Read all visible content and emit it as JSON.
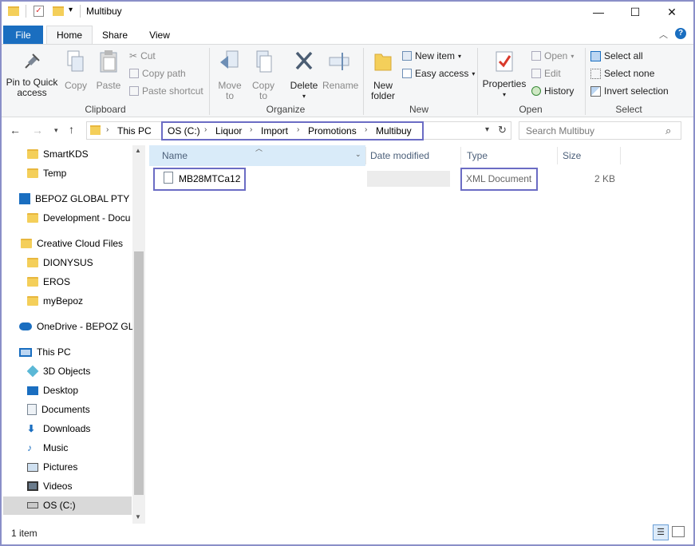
{
  "window": {
    "title": "Multibuy",
    "controls": {
      "minimize": "—",
      "maximize": "☐",
      "close": "✕"
    }
  },
  "ribbon_tabs": {
    "file": "File",
    "home": "Home",
    "share": "Share",
    "view": "View"
  },
  "ribbon": {
    "clipboard": {
      "label": "Clipboard",
      "pin": "Pin to Quick access",
      "copy": "Copy",
      "paste": "Paste",
      "cut": "Cut",
      "copy_path": "Copy path",
      "paste_shortcut": "Paste shortcut"
    },
    "organize": {
      "label": "Organize",
      "move_to": "Move to",
      "copy_to": "Copy to",
      "delete": "Delete",
      "rename": "Rename"
    },
    "new": {
      "label": "New",
      "new_folder": "New folder",
      "new_item": "New item",
      "easy_access": "Easy access"
    },
    "open": {
      "label": "Open",
      "properties": "Properties",
      "open": "Open",
      "edit": "Edit",
      "history": "History"
    },
    "select": {
      "label": "Select",
      "select_all": "Select all",
      "select_none": "Select none",
      "invert_selection": "Invert selection"
    }
  },
  "address": {
    "crumbs": [
      "This PC",
      "OS (C:)",
      "Liquor",
      "Import",
      "Promotions",
      "Multibuy"
    ],
    "search_placeholder": "Search Multibuy"
  },
  "nav_pane": [
    "SmartKDS",
    "Temp",
    "BEPOZ GLOBAL PTY LI",
    "Development - Docu",
    "Creative Cloud Files",
    "DIONYSUS",
    "EROS",
    "myBepoz",
    "OneDrive - BEPOZ GLC",
    "This PC",
    "3D Objects",
    "Desktop",
    "Documents",
    "Downloads",
    "Music",
    "Pictures",
    "Videos",
    "OS (C:)"
  ],
  "columns": {
    "name": "Name",
    "date_modified": "Date modified",
    "type": "Type",
    "size": "Size"
  },
  "files": [
    {
      "name": "MB28MTCa12",
      "date_modified": "",
      "type": "XML Document",
      "size": "2 KB"
    }
  ],
  "status": {
    "count": "1 item"
  },
  "colors": {
    "accent": "#1a6ec0",
    "highlight_box": "#6b6cc4",
    "folder": "#f4cf5a",
    "selected_row": "#cce8ff"
  }
}
